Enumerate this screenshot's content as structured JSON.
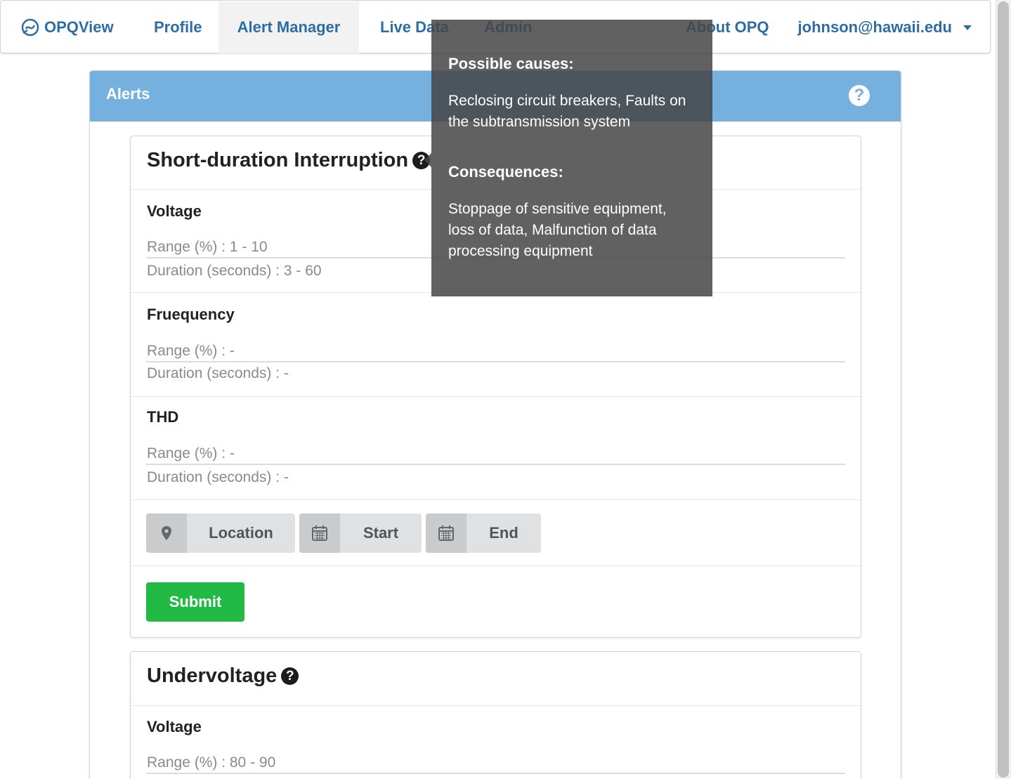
{
  "navbar": {
    "brand": "OPQView",
    "items": [
      {
        "label": "Profile"
      },
      {
        "label": "Alert Manager"
      },
      {
        "label": "Live Data"
      },
      {
        "label": "Admin"
      },
      {
        "label": "About OPQ"
      }
    ],
    "user": "johnson@hawaii.edu"
  },
  "alerts": {
    "title": "Alerts"
  },
  "card1": {
    "title": "Short-duration Interruption",
    "sections": [
      {
        "title": "Voltage",
        "range": "Range (%) : 1 - 10",
        "duration": "Duration (seconds) : 3 - 60"
      },
      {
        "title": "Fruequency",
        "range": "Range (%) : -",
        "duration": "Duration (seconds) : -"
      },
      {
        "title": "THD",
        "range": "Range (%) : -",
        "duration": "Duration (seconds) : -"
      }
    ],
    "buttons": {
      "location": "Location",
      "start": "Start",
      "end": "End"
    },
    "submit": "Submit"
  },
  "card2": {
    "title": "Undervoltage",
    "sections": [
      {
        "title": "Voltage",
        "range": "Range (%) : 80 - 90"
      }
    ]
  },
  "tooltip": {
    "causes_heading": "Possible causes:",
    "causes_text": "Reclosing circuit breakers, Faults on the subtransmission system",
    "consequences_heading": "Consequences:",
    "consequences_text": "Stoppage of sensitive equipment, loss of data, Malfunction of data processing equipment"
  },
  "colors": {
    "accent": "#2d6da3",
    "header": "#76b0df",
    "submit": "#21ba45"
  }
}
